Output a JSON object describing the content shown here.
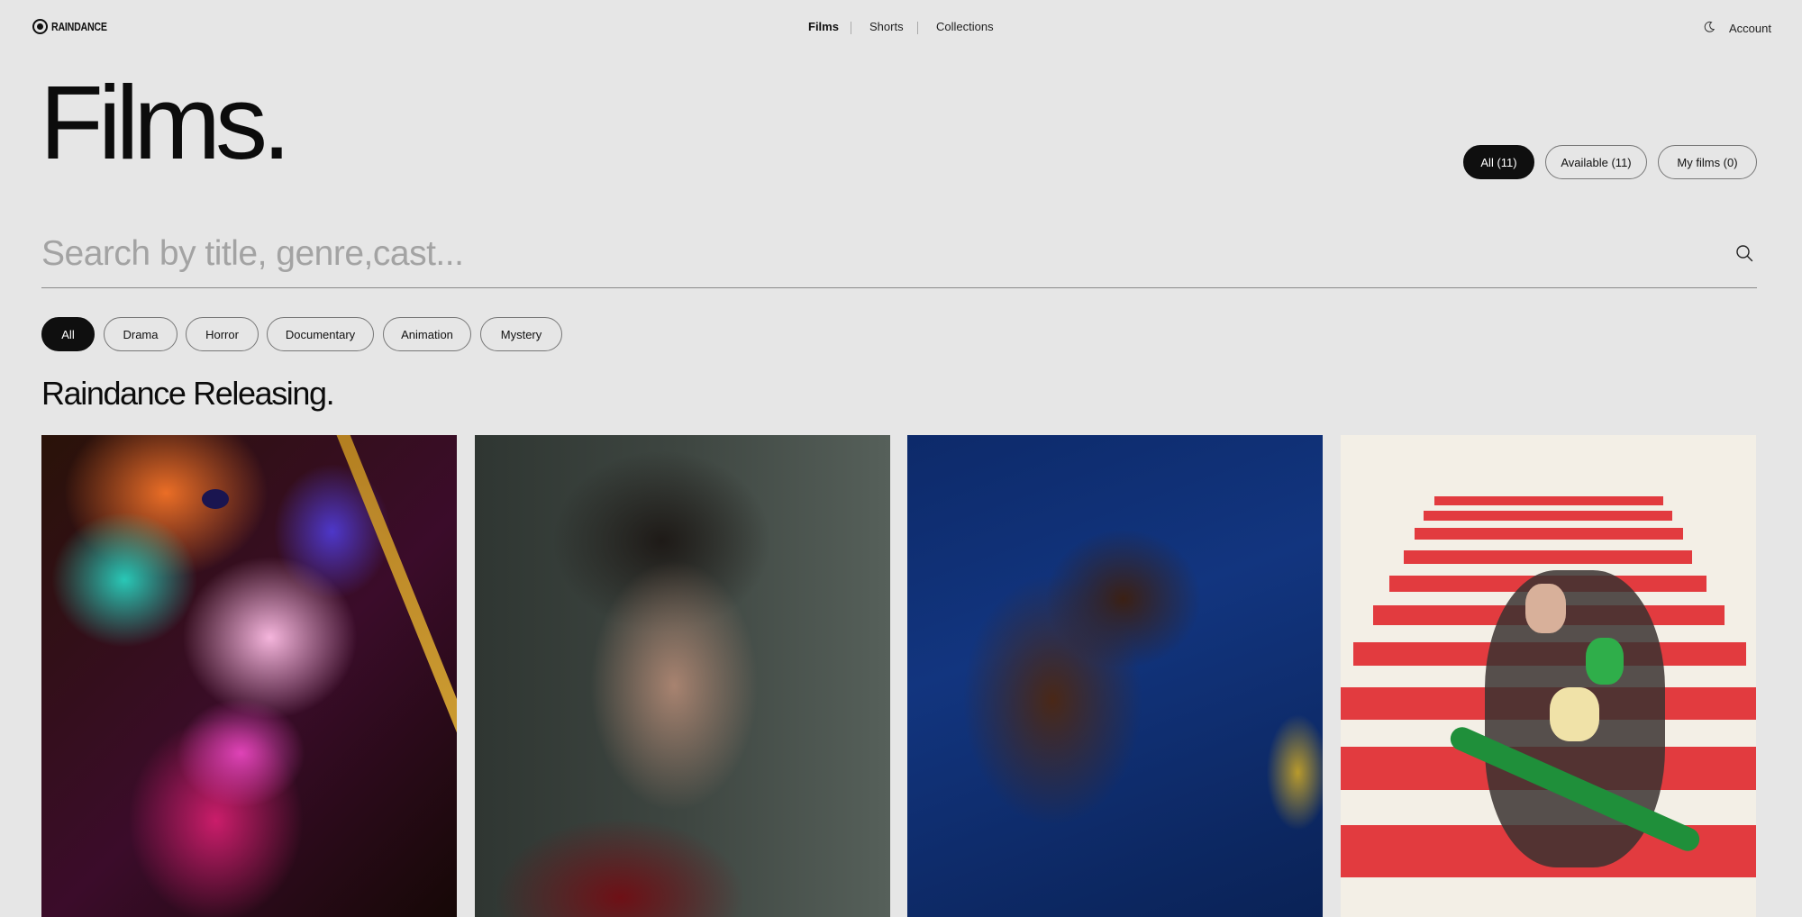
{
  "header": {
    "logo_text": "RAINDANCE",
    "nav": [
      {
        "label": "Films",
        "active": true
      },
      {
        "label": "Shorts",
        "active": false
      },
      {
        "label": "Collections",
        "active": false
      }
    ],
    "theme_icon": "moon-icon",
    "account_label": "Account"
  },
  "page_title": "Films.",
  "status_filters": [
    {
      "label": "All (11)",
      "active": true
    },
    {
      "label": "Available (11)",
      "active": false
    },
    {
      "label": "My films (0)",
      "active": false
    }
  ],
  "search": {
    "placeholder": "Search by title, genre,cast...",
    "value": "",
    "icon": "search-icon"
  },
  "genres": [
    {
      "label": "All",
      "active": true
    },
    {
      "label": "Drama",
      "active": false
    },
    {
      "label": "Horror",
      "active": false
    },
    {
      "label": "Documentary",
      "active": false
    },
    {
      "label": "Animation",
      "active": false
    },
    {
      "label": "Mystery",
      "active": false
    }
  ],
  "section_title": "Raindance Releasing.",
  "films": [
    {
      "poster": "neon-lit-face"
    },
    {
      "poster": "man-in-dim-room"
    },
    {
      "poster": "boy-on-blue-net"
    },
    {
      "poster": "illustrated-stripes-group"
    }
  ],
  "colors": {
    "background": "#e6e6e6",
    "accent": "#0f0f0f",
    "placeholder": "#a3a3a3",
    "poster_stripe": "#e23b3f"
  }
}
